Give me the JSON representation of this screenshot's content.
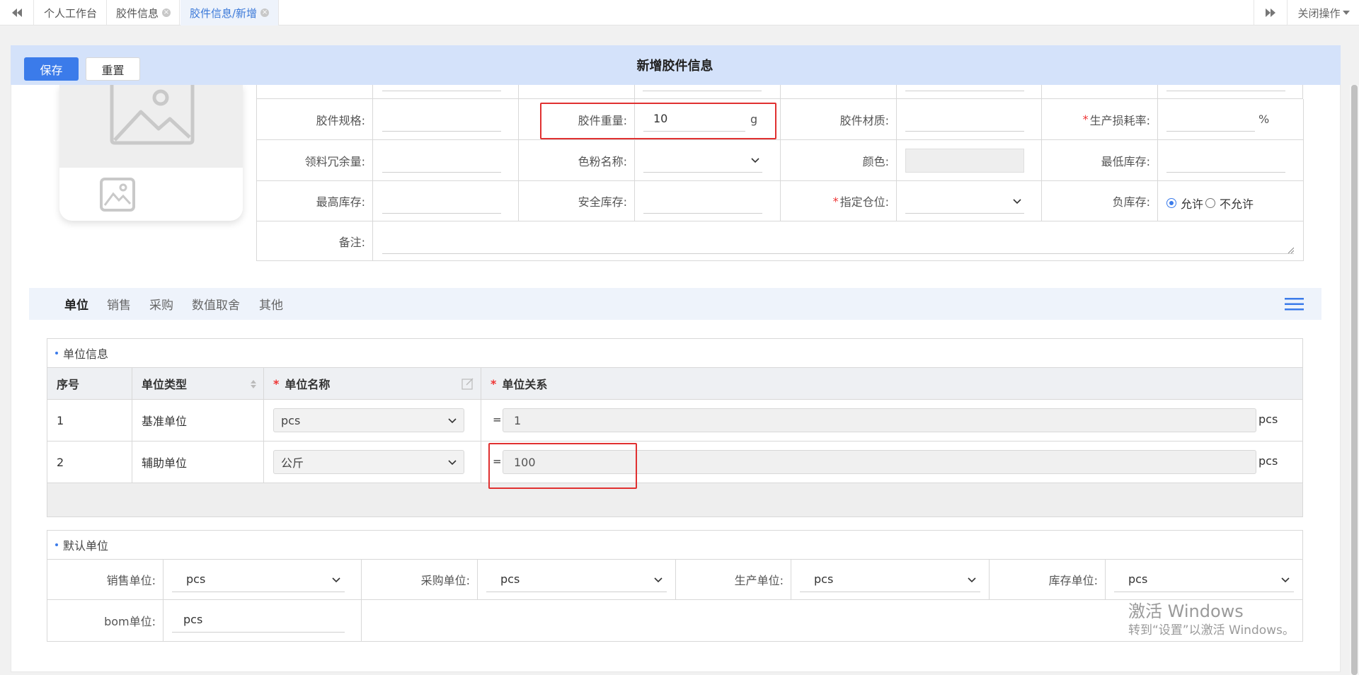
{
  "topbar": {
    "tabs": [
      {
        "label": "个人工作台",
        "closable": false,
        "active": false
      },
      {
        "label": "胶件信息",
        "closable": true,
        "active": false
      },
      {
        "label": "胶件信息/新增",
        "closable": true,
        "active": true
      }
    ],
    "close_ops_label": "关闭操作"
  },
  "header": {
    "save_label": "保存",
    "reset_label": "重置",
    "title": "新增胶件信息"
  },
  "form": {
    "spec_label": "胶件规格:",
    "spec_value": "",
    "weight_label": "胶件重量:",
    "weight_value": "10",
    "weight_unit": "g",
    "material_label": "胶件材质:",
    "material_value": "",
    "loss_rate_label": "生产损耗率:",
    "loss_rate_value": "",
    "loss_rate_unit": "%",
    "redundancy_label": "领料冗余量:",
    "redundancy_value": "",
    "toner_label": "色粉名称:",
    "toner_value": "",
    "color_label": "颜色:",
    "color_value": "",
    "min_stock_label": "最低库存:",
    "min_stock_value": "",
    "max_stock_label": "最高库存:",
    "max_stock_value": "",
    "safe_stock_label": "安全库存:",
    "safe_stock_value": "",
    "location_label": "指定仓位:",
    "location_value": "",
    "neg_stock_label": "负库存:",
    "neg_allow": "允许",
    "neg_disallow": "不允许",
    "neg_selected": "允许",
    "remark_label": "备注:",
    "remark_value": ""
  },
  "subtabs": {
    "items": [
      "单位",
      "销售",
      "采购",
      "数值取舍",
      "其他"
    ],
    "active": "单位"
  },
  "unit_info": {
    "title": "单位信息",
    "headers": {
      "seq": "序号",
      "type": "单位类型",
      "name": "单位名称",
      "relation": "单位关系"
    },
    "rows": [
      {
        "seq": "1",
        "type": "基准单位",
        "name": "pcs",
        "eq": "=",
        "relation_value": "1",
        "relation_unit": "pcs"
      },
      {
        "seq": "2",
        "type": "辅助单位",
        "name": "公斤",
        "eq": "=",
        "relation_value": "100",
        "relation_unit": "pcs"
      }
    ]
  },
  "default_units": {
    "title": "默认单位",
    "sales_label": "销售单位:",
    "sales_value": "pcs",
    "purchase_label": "采购单位:",
    "purchase_value": "pcs",
    "production_label": "生产单位:",
    "production_value": "pcs",
    "stock_label": "库存单位:",
    "stock_value": "pcs",
    "bom_label": "bom单位:",
    "bom_value": "pcs"
  },
  "watermark": {
    "line1": "激活 Windows",
    "line2": "转到“设置”以激活 Windows。"
  },
  "colors": {
    "primary": "#3b7bea",
    "header_bg": "#d4e2fa",
    "highlight": "#e03030"
  }
}
